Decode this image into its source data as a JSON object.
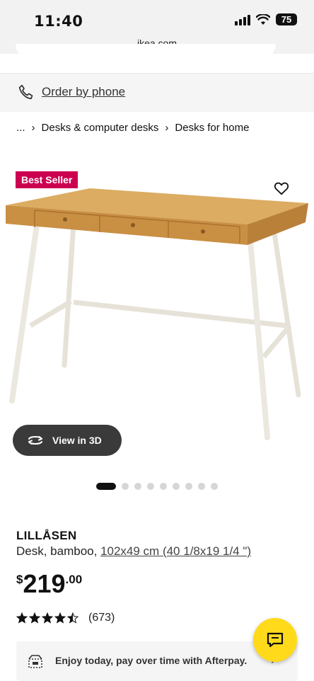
{
  "status": {
    "time": "11:40",
    "battery": "75",
    "icons": [
      "signal-icon",
      "wifi-icon",
      "battery-icon"
    ]
  },
  "browser": {
    "url": "ikea.com"
  },
  "order": {
    "label": "Order by phone",
    "icon": "phone-icon"
  },
  "breadcrumb": {
    "ellipsis": "...",
    "separator": "›",
    "items": [
      "Desks & computer desks",
      "Desks for home"
    ]
  },
  "product": {
    "badge": "Best Seller",
    "image_icons": [
      "heart-icon",
      "rotate-3d-icon"
    ],
    "view3d_label": "View in 3D",
    "carousel": {
      "total": 9,
      "active": 0
    },
    "name": "LILLÅSEN",
    "desc_prefix": "Desk, bamboo, ",
    "dims": "102x49 cm (40 1/8x19 1/4 \")",
    "price": {
      "currency": "$",
      "integer": "219",
      "decimal": ".00"
    },
    "rating": {
      "value": 4.5,
      "count": "(673)"
    }
  },
  "afterpay": {
    "text": "Enjoy today, pay over time with Afterpay.",
    "chevron": "›"
  },
  "colors": {
    "badge": "#cc0050",
    "chat": "#ffda1a",
    "desk_wood": "#d9a456",
    "desk_frame": "#ebe8e0"
  }
}
